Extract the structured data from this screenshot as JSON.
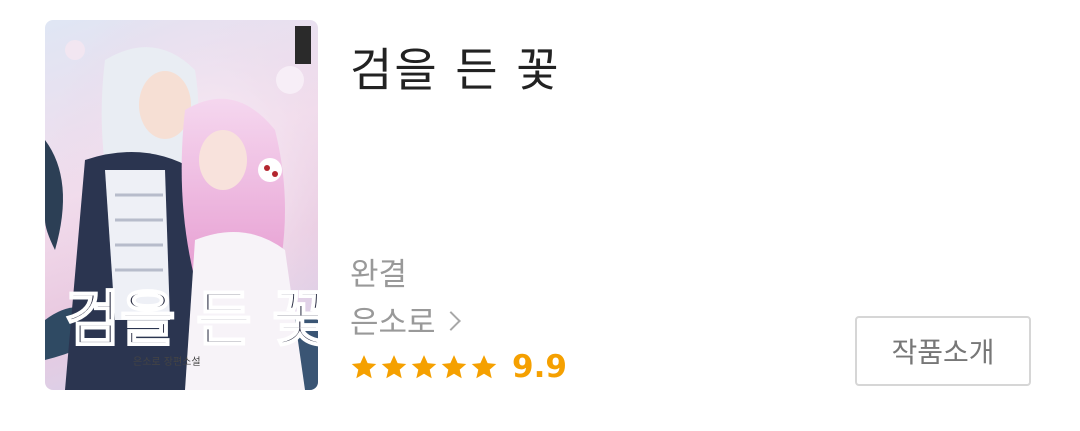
{
  "work": {
    "title": "검을 든 꽃",
    "status": "완결",
    "author": "은소로",
    "rating": "9.9",
    "stars_filled": 5,
    "stars_total": 5,
    "star_color": "#f5a000"
  },
  "buttons": {
    "intro_label": "작품소개"
  },
  "cover": {
    "title_text": "검을 든 꽃",
    "subtitle_text": "은소로 장편소설"
  }
}
